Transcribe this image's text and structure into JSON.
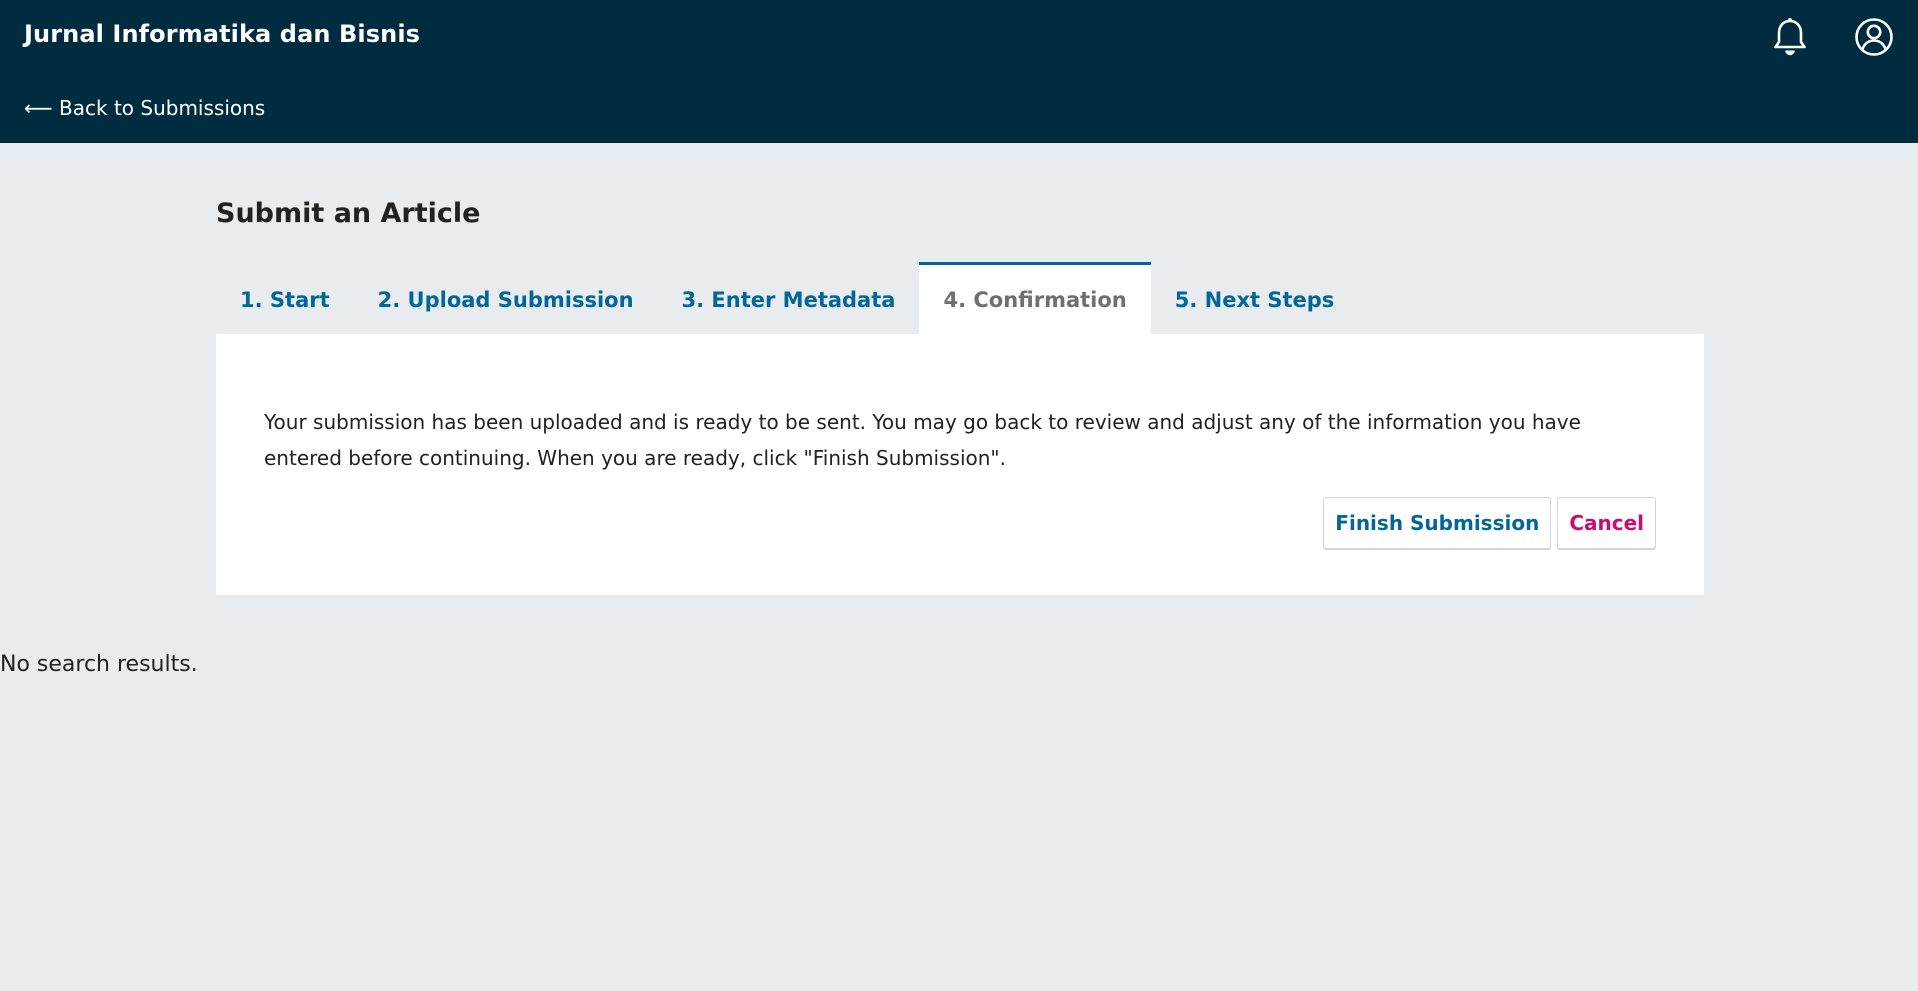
{
  "header": {
    "site_title": "Jurnal Informatika dan Bisnis",
    "back_link": "⟵ Back to Submissions",
    "icons": [
      "bell-icon",
      "user-circle-icon"
    ]
  },
  "main": {
    "page_title": "Submit an Article",
    "tabs": [
      {
        "label": "1. Start",
        "active": false
      },
      {
        "label": "2. Upload Submission",
        "active": false
      },
      {
        "label": "3. Enter Metadata",
        "active": false
      },
      {
        "label": "4. Confirmation",
        "active": true
      },
      {
        "label": "5. Next Steps",
        "active": false
      }
    ],
    "confirmation": {
      "message": "Your submission has been uploaded and is ready to be sent. You may go back to review and adjust any of the information you have entered before continuing. When you are ready, click \"Finish Submission\".",
      "finish_label": "Finish Submission",
      "cancel_label": "Cancel"
    }
  },
  "search": {
    "no_results": "No search results."
  },
  "colors": {
    "header_bg": "#002c40",
    "link": "#006798",
    "cancel": "#d00a6c",
    "page_bg": "#e9ecee"
  }
}
